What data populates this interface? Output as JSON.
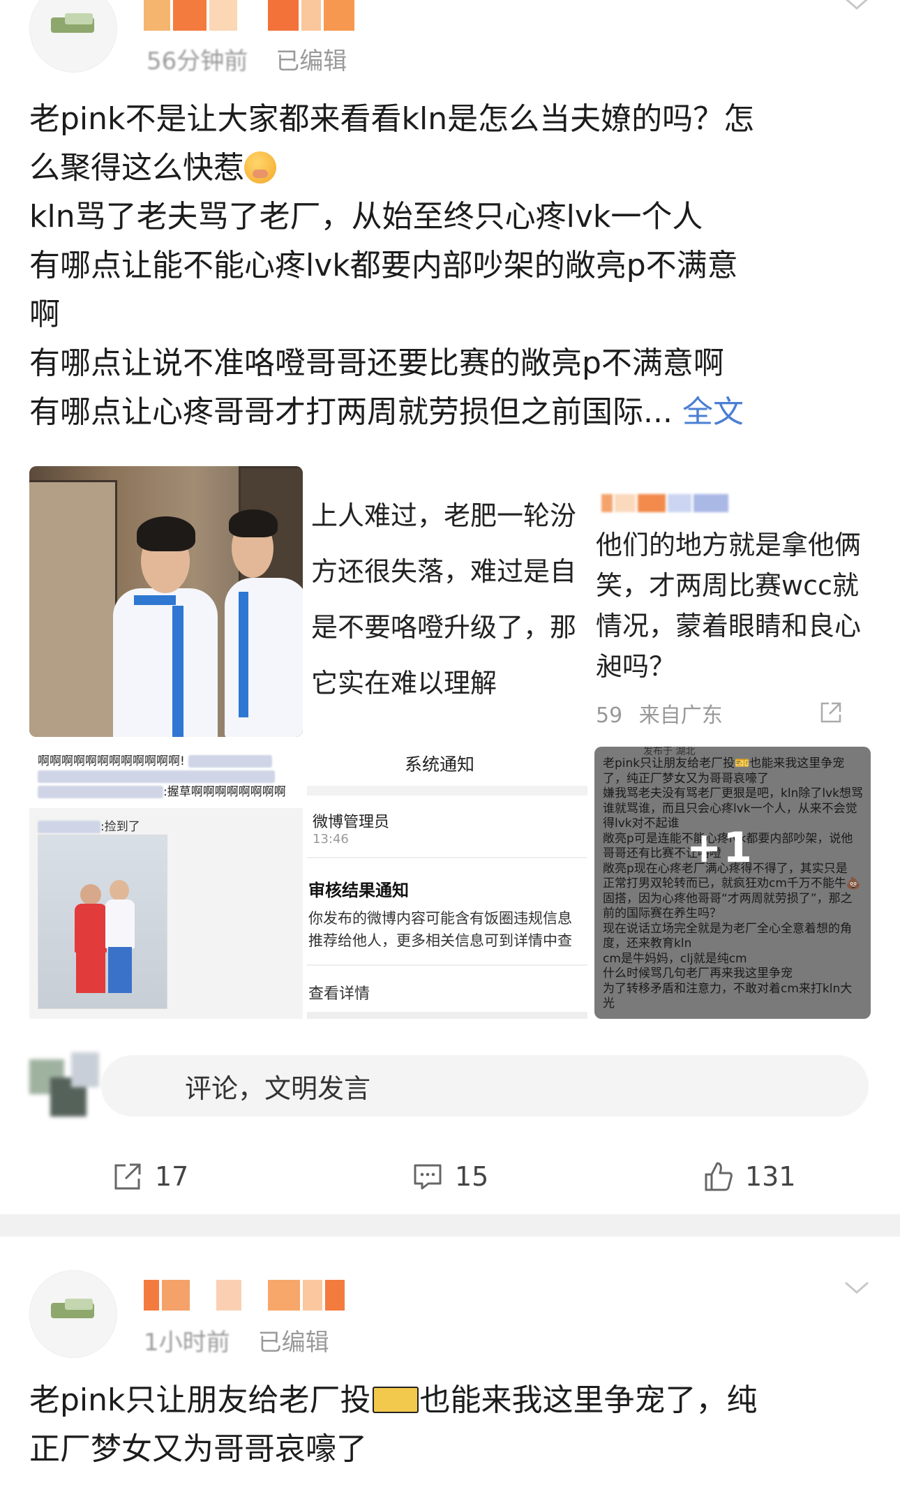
{
  "post1": {
    "time": "56分钟前",
    "edited": "已编辑",
    "lines": [
      "老pink不是让大家都来看看kln是怎么当夫嫽的吗？怎",
      "么聚得这么快惹",
      "kln骂了老夫骂了老厂，从始至终只心疼lvk一个人",
      "有哪点让能不能心疼lvk都要内部吵架的敞亮p不满意",
      "啊",
      "有哪点让说不准咯噔哥哥还要比赛的敞亮p不满意啊",
      "有哪点让心疼哥哥才打两周就劳损但之前国际..."
    ],
    "more": "全文",
    "images": {
      "tile2_lines": [
        "上人难过，老肥一轮汾",
        "方还很失落，难过是自",
        "是不要咯噔升级了，那",
        "它实在难以理解"
      ],
      "tile3_lines": [
        "他们的地方就是拿他俩",
        "笑，才两周比赛wcc就",
        "情况，蒙着眼睛和良心",
        "昶吗？"
      ],
      "tile3_count": "59",
      "tile3_location": "来自广东",
      "tile4_line1": "啊啊啊啊啊啊啊啊啊啊啊啊!",
      "tile4_line3": ":握草啊啊啊啊啊啊啊啊",
      "tile4_caption": ":捡到了",
      "tile5_title": "系统通知",
      "tile5_sender": "微博管理员",
      "tile5_time": "13:46",
      "tile5_heading": "审核结果通知",
      "tile5_body1": "你发布的微博内容可能含有饭圈违规信息",
      "tile5_body2": "推荐给他人，更多相关信息可到详情中查",
      "tile5_link": "查看详情",
      "tile6_header": "发布于 湖北",
      "tile6_lines": [
        "老pink只让朋友给老厂投🎫也能来我这里争宠",
        "了，纯正厂梦女又为哥哥哀嚎了",
        "嫌我骂老夫没有骂老厂更狠是吧，kln除了lvk想骂",
        "谁就骂谁，而且只会心疼lvk一个人，从来不会觉",
        "得lvk对不起谁",
        "敞亮p可是连能不能心疼lvk都要内部吵架，说他",
        "哥哥还有比赛不让咯噔",
        "敞亮p现在心疼老厂满心疼得不得了，其实只是",
        "正常打男双轮转而已，就疯狂劝cm千万不能牛💩",
        "固搭，因为心疼他哥哥“才两周就劳损了”，那之",
        "前的国际赛在养生吗？",
        "现在说话立场完全就是为老厂全心全意着想的角",
        "度，还来教育kln",
        "cm是牛妈妈，clj就是纯cm",
        "什么时候骂几句老厂再来我这里争宠",
        "为了转移矛盾和注意力，不敢对着cm来打kln大光"
      ],
      "plus": "+1"
    },
    "comment_placeholder": "评论，文明发言",
    "actions": {
      "repost": "17",
      "comment": "15",
      "like": "131"
    }
  },
  "post2": {
    "time": "1小时前",
    "edited": "已编辑",
    "line1_a": "老pink只让朋友给老厂投",
    "line1_b": "也能来我这里争宠了，纯",
    "line2": "正厂梦女又为哥哥哀嚎了"
  },
  "colors": {
    "link": "#4a7fd4",
    "text": "#1c1c1c",
    "meta": "#9a9a9a",
    "divider": "#f1f1f1"
  }
}
